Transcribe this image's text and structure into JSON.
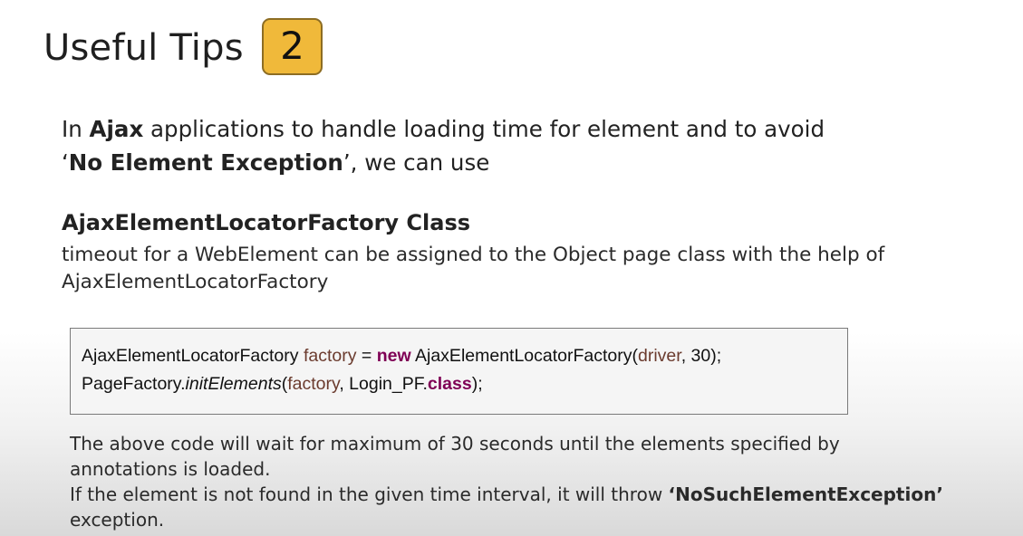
{
  "header": {
    "title": "Useful Tips",
    "badge": "2"
  },
  "intro": {
    "p1": "In ",
    "b1": "Ajax",
    "p2": " applications to handle loading time for element and to avoid",
    "q_open": "‘",
    "b2": "No Element Exception",
    "q_close": "’",
    "p3": ", we can use"
  },
  "section": {
    "heading": "AjaxElementLocatorFactory Class",
    "description_line1": "timeout for a WebElement can be assigned to the Object page class with the help of",
    "description_line2": "AjaxElementLocatorFactory"
  },
  "code": {
    "line1": {
      "type": "AjaxElementLocatorFactory ",
      "var": "factory",
      "eq": " = ",
      "kw_new": "new",
      "ctor": " AjaxElementLocatorFactory(",
      "arg_driver": "driver",
      "rest": ", 30);"
    },
    "line2": {
      "obj": "PageFactory.",
      "method": "initElements",
      "open": "(",
      "arg_factory": "factory",
      "mid": ", Login_PF.",
      "kw_class": "class",
      "close": ");"
    }
  },
  "note": {
    "line1": "The above code will wait for maximum of 30 seconds until the elements specified by",
    "line2": "annotations is loaded.",
    "line3a": "If the element is not found in the given time interval, it will throw ",
    "line3b": "‘NoSuchElementException’",
    "line4": "exception."
  }
}
